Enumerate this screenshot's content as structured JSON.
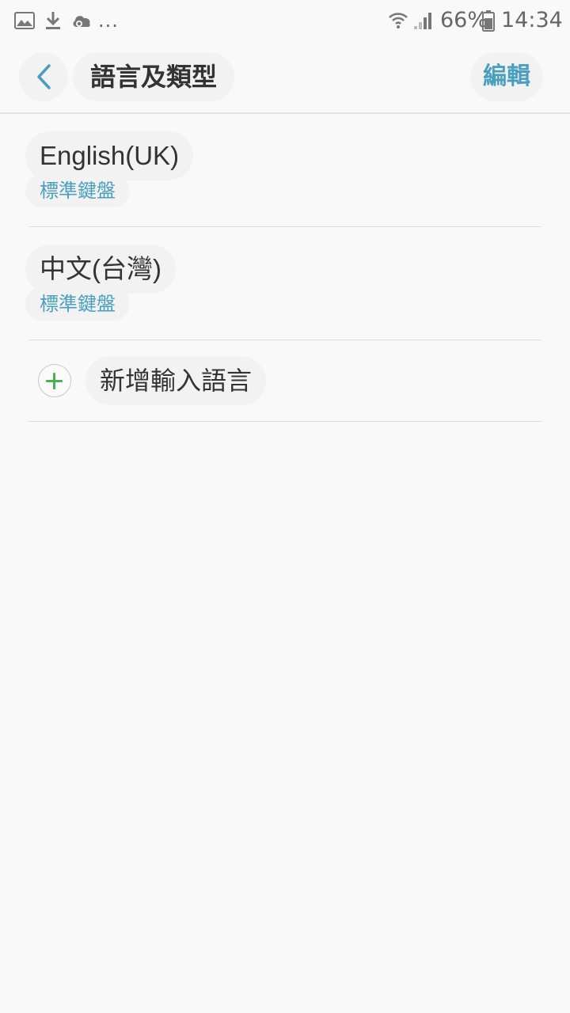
{
  "status_bar": {
    "battery_percent": "66%",
    "time": "14:34",
    "overflow": "...",
    "icons": [
      "gallery-icon",
      "download-icon",
      "cloud-sync-icon",
      "wifi-icon",
      "signal-icon",
      "battery-icon"
    ]
  },
  "header": {
    "title": "語言及類型",
    "edit_label": "編輯",
    "back_icon": "chevron-left-icon"
  },
  "languages": [
    {
      "name": "English(UK)",
      "keyboard": "標準鍵盤"
    },
    {
      "name": "中文(台灣)",
      "keyboard": "標準鍵盤"
    }
  ],
  "add_language": {
    "label": "新增輸入語言",
    "icon": "plus-circle-icon"
  },
  "colors": {
    "accent": "#4a9fbf",
    "add_green": "#4caf50",
    "text_primary": "#333333",
    "background": "#f9f9f9"
  }
}
